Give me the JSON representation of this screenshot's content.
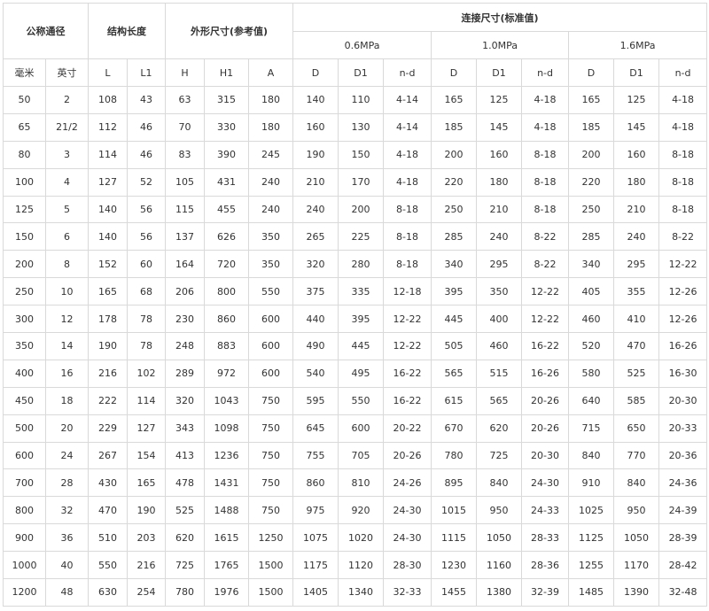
{
  "header": {
    "nominal_diameter": "公称通径",
    "structure_length": "结构长度",
    "outer_dims": "外形尺寸(参考值)",
    "connection_dims": "连接尺寸(标准值)",
    "pressures": [
      "0.6MPa",
      "1.0MPa",
      "1.6MPa"
    ],
    "subcolumns": [
      "毫米",
      "英寸",
      "L",
      "L1",
      "H",
      "H1",
      "A",
      "D",
      "D1",
      "n-d",
      "D",
      "D1",
      "n-d",
      "D",
      "D1",
      "n-d"
    ]
  },
  "rows": [
    [
      "50",
      "2",
      "108",
      "43",
      "63",
      "315",
      "180",
      "140",
      "110",
      "4-14",
      "165",
      "125",
      "4-18",
      "165",
      "125",
      "4-18"
    ],
    [
      "65",
      "21/2",
      "112",
      "46",
      "70",
      "330",
      "180",
      "160",
      "130",
      "4-14",
      "185",
      "145",
      "4-18",
      "185",
      "145",
      "4-18"
    ],
    [
      "80",
      "3",
      "114",
      "46",
      "83",
      "390",
      "245",
      "190",
      "150",
      "4-18",
      "200",
      "160",
      "8-18",
      "200",
      "160",
      "8-18"
    ],
    [
      "100",
      "4",
      "127",
      "52",
      "105",
      "431",
      "240",
      "210",
      "170",
      "4-18",
      "220",
      "180",
      "8-18",
      "220",
      "180",
      "8-18"
    ],
    [
      "125",
      "5",
      "140",
      "56",
      "115",
      "455",
      "240",
      "240",
      "200",
      "8-18",
      "250",
      "210",
      "8-18",
      "250",
      "210",
      "8-18"
    ],
    [
      "150",
      "6",
      "140",
      "56",
      "137",
      "626",
      "350",
      "265",
      "225",
      "8-18",
      "285",
      "240",
      "8-22",
      "285",
      "240",
      "8-22"
    ],
    [
      "200",
      "8",
      "152",
      "60",
      "164",
      "720",
      "350",
      "320",
      "280",
      "8-18",
      "340",
      "295",
      "8-22",
      "340",
      "295",
      "12-22"
    ],
    [
      "250",
      "10",
      "165",
      "68",
      "206",
      "800",
      "550",
      "375",
      "335",
      "12-18",
      "395",
      "350",
      "12-22",
      "405",
      "355",
      "12-26"
    ],
    [
      "300",
      "12",
      "178",
      "78",
      "230",
      "860",
      "600",
      "440",
      "395",
      "12-22",
      "445",
      "400",
      "12-22",
      "460",
      "410",
      "12-26"
    ],
    [
      "350",
      "14",
      "190",
      "78",
      "248",
      "883",
      "600",
      "490",
      "445",
      "12-22",
      "505",
      "460",
      "16-22",
      "520",
      "470",
      "16-26"
    ],
    [
      "400",
      "16",
      "216",
      "102",
      "289",
      "972",
      "600",
      "540",
      "495",
      "16-22",
      "565",
      "515",
      "16-26",
      "580",
      "525",
      "16-30"
    ],
    [
      "450",
      "18",
      "222",
      "114",
      "320",
      "1043",
      "750",
      "595",
      "550",
      "16-22",
      "615",
      "565",
      "20-26",
      "640",
      "585",
      "20-30"
    ],
    [
      "500",
      "20",
      "229",
      "127",
      "343",
      "1098",
      "750",
      "645",
      "600",
      "20-22",
      "670",
      "620",
      "20-26",
      "715",
      "650",
      "20-33"
    ],
    [
      "600",
      "24",
      "267",
      "154",
      "413",
      "1236",
      "750",
      "755",
      "705",
      "20-26",
      "780",
      "725",
      "20-30",
      "840",
      "770",
      "20-36"
    ],
    [
      "700",
      "28",
      "430",
      "165",
      "478",
      "1431",
      "750",
      "860",
      "810",
      "24-26",
      "895",
      "840",
      "24-30",
      "910",
      "840",
      "24-36"
    ],
    [
      "800",
      "32",
      "470",
      "190",
      "525",
      "1488",
      "750",
      "975",
      "920",
      "24-30",
      "1015",
      "950",
      "24-33",
      "1025",
      "950",
      "24-39"
    ],
    [
      "900",
      "36",
      "510",
      "203",
      "620",
      "1615",
      "1250",
      "1075",
      "1020",
      "24-30",
      "1115",
      "1050",
      "28-33",
      "1125",
      "1050",
      "28-39"
    ],
    [
      "1000",
      "40",
      "550",
      "216",
      "725",
      "1765",
      "1500",
      "1175",
      "1120",
      "28-30",
      "1230",
      "1160",
      "28-36",
      "1255",
      "1170",
      "28-42"
    ],
    [
      "1200",
      "48",
      "630",
      "254",
      "780",
      "1976",
      "1500",
      "1405",
      "1340",
      "32-33",
      "1455",
      "1380",
      "32-39",
      "1485",
      "1390",
      "32-48"
    ]
  ]
}
